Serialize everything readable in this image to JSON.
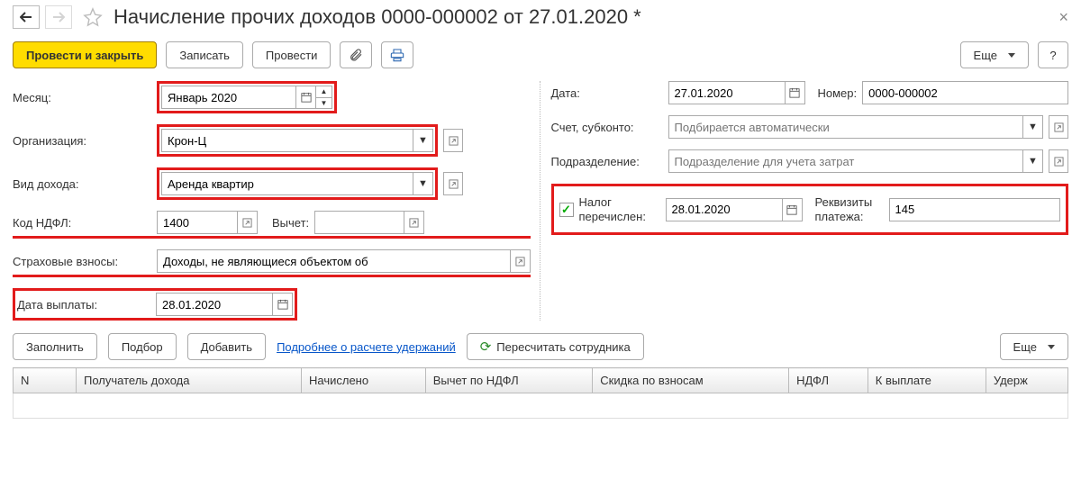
{
  "header": {
    "title": "Начисление прочих доходов 0000-000002 от 27.01.2020 *"
  },
  "toolbar": {
    "post_close": "Провести и закрыть",
    "save": "Записать",
    "post": "Провести",
    "more": "Еще",
    "help": "?"
  },
  "fields": {
    "month_label": "Месяц:",
    "month_value": "Январь 2020",
    "org_label": "Организация:",
    "org_value": "Крон-Ц",
    "income_type_label": "Вид дохода:",
    "income_type_value": "Аренда квартир",
    "ndfl_code_label": "Код НДФЛ:",
    "ndfl_code_value": "1400",
    "deduction_label": "Вычет:",
    "deduction_value": "",
    "insurance_label": "Страховые взносы:",
    "insurance_value": "Доходы, не являющиеся объектом об",
    "pay_date_label": "Дата выплаты:",
    "pay_date_value": "28.01.2020",
    "date_label": "Дата:",
    "date_value": "27.01.2020",
    "number_label": "Номер:",
    "number_value": "0000-000002",
    "account_label": "Счет, субконто:",
    "account_ph": "Подбирается автоматически",
    "dept_label": "Подразделение:",
    "dept_ph": "Подразделение для учета затрат",
    "tax_paid_label": "Налог перечислен:",
    "tax_paid_checked": true,
    "tax_paid_date": "28.01.2020",
    "pay_details_label": "Реквизиты платежа:",
    "pay_details_value": "145"
  },
  "subtoolbar": {
    "fill": "Заполнить",
    "pick": "Подбор",
    "add": "Добавить",
    "details_link": "Подробнее о расчете удержаний",
    "recalc": "Пересчитать сотрудника",
    "more": "Еще"
  },
  "table": {
    "cols": {
      "n": "N",
      "recipient": "Получатель дохода",
      "accrued": "Начислено",
      "ndfl_deduction": "Вычет по НДФЛ",
      "contrib_discount": "Скидка по взносам",
      "ndfl": "НДФЛ",
      "to_pay": "К выплате",
      "withhold": "Удерж"
    }
  }
}
